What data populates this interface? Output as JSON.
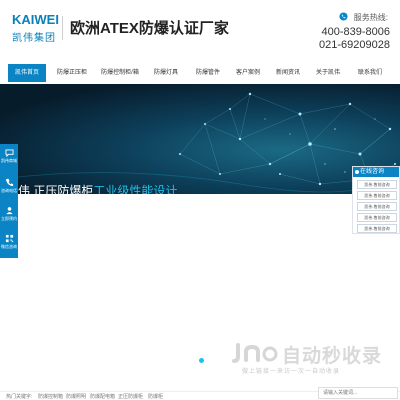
{
  "header": {
    "logo_en": "KAIWEI",
    "logo_cn": "凯伟集团",
    "title": "欧洲ATEX防爆认证厂家",
    "hotline_label": "服务热线:",
    "phones": [
      "400-839-8006",
      "021-69209028"
    ]
  },
  "nav": {
    "items": [
      "凯伟首页",
      "防爆正压柜",
      "防爆控制柜/箱",
      "防爆灯具",
      "防爆管件",
      "客户案例",
      "新闻资讯",
      "关于凯伟",
      "联系我们"
    ]
  },
  "banner": {
    "text_main": "伟 正压防爆柜",
    "text_highlight": "工业级性能设计"
  },
  "left_float": {
    "items": [
      "凯伟商城",
      "咨询电话",
      "立即预约",
      "微信咨询"
    ]
  },
  "service": {
    "title": "在线咨询",
    "items": [
      "凯伟-售前咨询",
      "凯伟-售前咨询",
      "凯伟-售前咨询",
      "凯伟-售前咨询",
      "凯伟-售前咨询"
    ]
  },
  "watermark": {
    "title": "自动秒收录",
    "subtitle": "做上链接一来访一次一自动收录"
  },
  "keywords": {
    "label": "热门关键字:",
    "items": [
      "防爆控制箱",
      "防爆照明",
      "防爆配电箱",
      "正压防爆柜",
      "防爆柜"
    ]
  },
  "search": {
    "placeholder": "请输入关键词..."
  },
  "colors": {
    "brand": "#0a84c4",
    "accent": "#1ec1e8"
  }
}
